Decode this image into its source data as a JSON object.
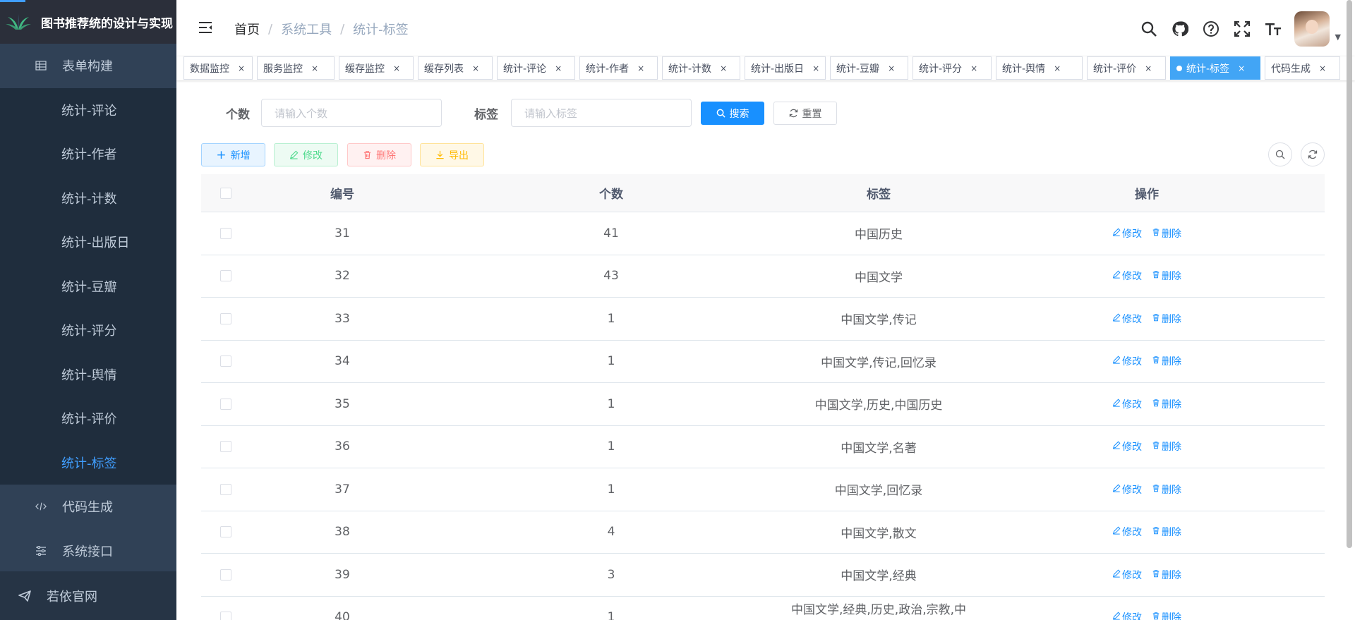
{
  "app": {
    "title": "图书推荐统的设计与实现"
  },
  "sidebar": {
    "items": [
      {
        "label": "表单构建",
        "icon": "table-icon",
        "type": "top"
      },
      {
        "label": "统计-评论",
        "type": "sub"
      },
      {
        "label": "统计-作者",
        "type": "sub"
      },
      {
        "label": "统计-计数",
        "type": "sub"
      },
      {
        "label": "统计-出版日",
        "type": "sub"
      },
      {
        "label": "统计-豆瓣",
        "type": "sub"
      },
      {
        "label": "统计-评分",
        "type": "sub"
      },
      {
        "label": "统计-舆情",
        "type": "sub"
      },
      {
        "label": "统计-评价",
        "type": "sub"
      },
      {
        "label": "统计-标签",
        "type": "sub",
        "active": true
      },
      {
        "label": "代码生成",
        "icon": "code-icon",
        "type": "top"
      },
      {
        "label": "系统接口",
        "icon": "sliders-icon",
        "type": "top"
      }
    ],
    "bottom_label": "若依官网"
  },
  "breadcrumb": [
    "首页",
    "系统工具",
    "统计-标签"
  ],
  "tags": [
    {
      "label": "数据监控"
    },
    {
      "label": "服务监控"
    },
    {
      "label": "缓存监控"
    },
    {
      "label": "缓存列表"
    },
    {
      "label": "统计-评论"
    },
    {
      "label": "统计-作者"
    },
    {
      "label": "统计-计数"
    },
    {
      "label": "统计-出版日"
    },
    {
      "label": "统计-豆瓣"
    },
    {
      "label": "统计-评分"
    },
    {
      "label": "统计-舆情"
    },
    {
      "label": "统计-评价"
    },
    {
      "label": "统计-标签",
      "active": true
    },
    {
      "label": "代码生成"
    }
  ],
  "search": {
    "count_label": "个数",
    "count_placeholder": "请输入个数",
    "tag_label": "标签",
    "tag_placeholder": "请输入标签",
    "search_button": "搜索",
    "reset_button": "重置"
  },
  "toolbar": {
    "add": "新增",
    "edit": "修改",
    "delete": "删除",
    "export": "导出"
  },
  "table": {
    "headers": {
      "id": "编号",
      "count": "个数",
      "tag": "标签",
      "ops": "操作"
    },
    "op_edit": "修改",
    "op_delete": "删除",
    "rows": [
      {
        "id": "31",
        "count": "41",
        "tag": "中国历史"
      },
      {
        "id": "32",
        "count": "43",
        "tag": "中国文学"
      },
      {
        "id": "33",
        "count": "1",
        "tag": "中国文学,传记"
      },
      {
        "id": "34",
        "count": "1",
        "tag": "中国文学,传记,回忆录"
      },
      {
        "id": "35",
        "count": "1",
        "tag": "中国文学,历史,中国历史"
      },
      {
        "id": "36",
        "count": "1",
        "tag": "中国文学,名著"
      },
      {
        "id": "37",
        "count": "1",
        "tag": "中国文学,回忆录"
      },
      {
        "id": "38",
        "count": "4",
        "tag": "中国文学,散文"
      },
      {
        "id": "39",
        "count": "3",
        "tag": "中国文学,经典"
      },
      {
        "id": "40",
        "count": "1",
        "tag": "中国文学,经典,历史,政治,宗教,中国历史"
      }
    ]
  },
  "colors": {
    "sidebar_bg": "#304156",
    "primary": "#1890ff",
    "active_menu": "#409eff"
  }
}
